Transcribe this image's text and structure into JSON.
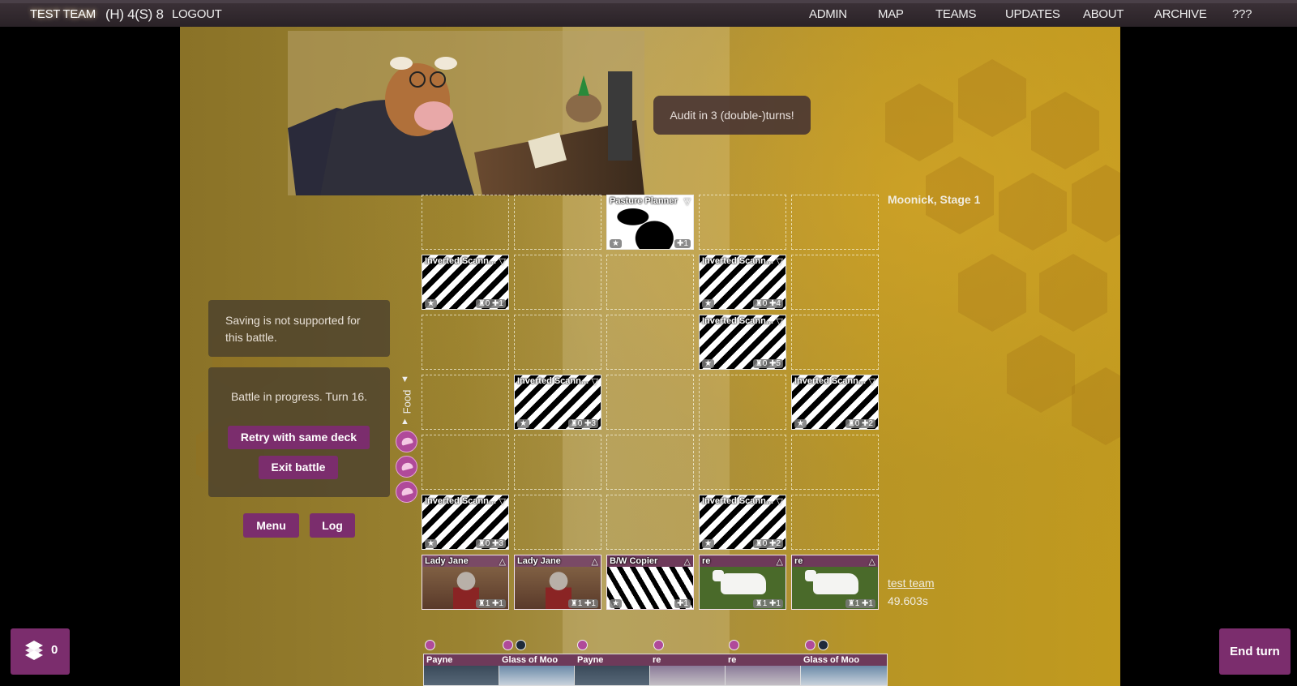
{
  "topbar": {
    "team": "TEST TEAM",
    "points": "(H) 4(S) 8",
    "logout": "LOGOUT",
    "nav": [
      "ADMIN",
      "MAP",
      "TEAMS",
      "UPDATES",
      "ABOUT",
      "ARCHIVE",
      "???"
    ]
  },
  "audit": "Audit in 3 (double-)turns!",
  "enemy_label": "Moonick, Stage 1",
  "player": {
    "name": "test team",
    "time": "49.603s"
  },
  "save_notice": "Saving is not supported for this battle.",
  "battle": {
    "status": "Battle in progress. Turn 16.",
    "retry": "Retry with same deck",
    "exit": "Exit battle"
  },
  "buttons": {
    "menu": "Menu",
    "log": "Log",
    "end_turn": "End turn"
  },
  "food": {
    "label": "Food",
    "count": 3
  },
  "deck": {
    "count": "0"
  },
  "board": {
    "enemy_backline": [
      null,
      null,
      {
        "name": "Pasture Planner",
        "left": "",
        "right": "1",
        "art": "pasture"
      },
      null,
      null
    ],
    "enemy_row2": [
      {
        "name": "Inverted Scann...",
        "left": "",
        "right": "0 1",
        "art": "zebra"
      },
      null,
      null,
      {
        "name": "Inverted Scann...",
        "left": "",
        "right": "0 4",
        "art": "zebra"
      },
      null
    ],
    "enemy_row3": [
      null,
      null,
      null,
      {
        "name": "Inverted Scann...",
        "left": "",
        "right": "0 5",
        "art": "zebra"
      },
      null
    ],
    "enemy_row4": [
      null,
      {
        "name": "Inverted Scann...",
        "left": "",
        "right": "0 3",
        "art": "zebra"
      },
      null,
      null,
      {
        "name": "Inverted Scann...",
        "left": "",
        "right": "0 2",
        "art": "zebra"
      }
    ],
    "enemy_front": [
      {
        "name": "Inverted Scann...",
        "left": "",
        "right": "0 3",
        "art": "zebra"
      },
      null,
      null,
      {
        "name": "Inverted Scann...",
        "left": "",
        "right": "0 2",
        "art": "zebra"
      },
      null
    ],
    "player_row": [
      {
        "name": "Lady Jane",
        "right": "1 1",
        "art": "lady"
      },
      {
        "name": "Lady Jane",
        "right": "1 1",
        "art": "lady"
      },
      {
        "name": "B/W Copier",
        "right": "1",
        "art": "zebra2"
      },
      {
        "name": "re",
        "right": "1 1",
        "art": "cow"
      },
      {
        "name": "re",
        "right": "1 1",
        "art": "cow"
      }
    ]
  },
  "hand": [
    {
      "name": "Payne",
      "art": "payne"
    },
    {
      "name": "Glass of Moo",
      "art": "glass"
    },
    {
      "name": "Payne",
      "art": "payne"
    },
    {
      "name": "re",
      "art": "cow"
    },
    {
      "name": "re",
      "art": "cow"
    },
    {
      "name": "Glass of Moo",
      "art": "glass"
    }
  ],
  "colors": {
    "accent": "#7b2d6d",
    "food": "#b04a9a"
  }
}
